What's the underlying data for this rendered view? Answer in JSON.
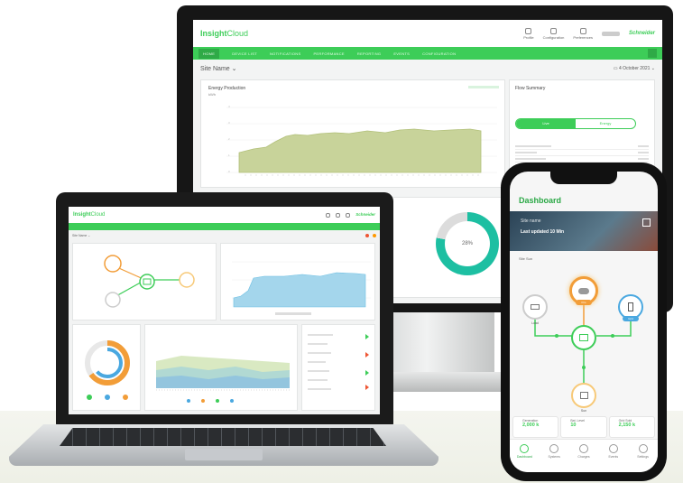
{
  "monitor": {
    "app_name_bold": "Insight",
    "app_name_light": "Cloud",
    "brand": "Schneider",
    "header_tools": [
      "Profile",
      "Configuration",
      "Preferences"
    ],
    "nav": [
      "HOME",
      "DEVICE LIST",
      "NOTIFICATIONS",
      "PERFORMANCE",
      "REPORTING",
      "EVENTS",
      "CONFIGURATION"
    ],
    "site_name": "Site Name ⌄",
    "date": "4 October 2021",
    "energy_panel": {
      "title": "Energy Production",
      "unit": "kWh"
    },
    "flow_panel": {
      "title": "Flow Summary",
      "toggle_on": "Live",
      "toggle_off": "Energy"
    },
    "gauge": {
      "value": "28%",
      "fraction": 0.78
    }
  },
  "laptop": {
    "app_name_bold": "Insight",
    "app_name_light": "Cloud",
    "brand": "Schneider",
    "site_name": "Site Name ⌄"
  },
  "phone": {
    "title": "Dashboard",
    "banner_line1": "Site name",
    "banner_line2": "Last updated 10 Min",
    "site_label": "Site  Sun",
    "nodes": [
      "Load",
      "Pcs",
      "Grid",
      "Sun"
    ],
    "stats": [
      {
        "label": "Generation",
        "value": "2,000 k"
      },
      {
        "label": "Bat. Level",
        "value": "10"
      },
      {
        "label": "Grid Sold",
        "value": "2,150 k"
      }
    ],
    "tabs": [
      "Dashboard",
      "Systems",
      "Charges",
      "Events",
      "Settings"
    ]
  },
  "colors": {
    "accent": "#3dcd58",
    "chart_fill": "#c8d39a",
    "laptop_chart": "#a4d6ec",
    "gauge": "#1dbfa2"
  }
}
